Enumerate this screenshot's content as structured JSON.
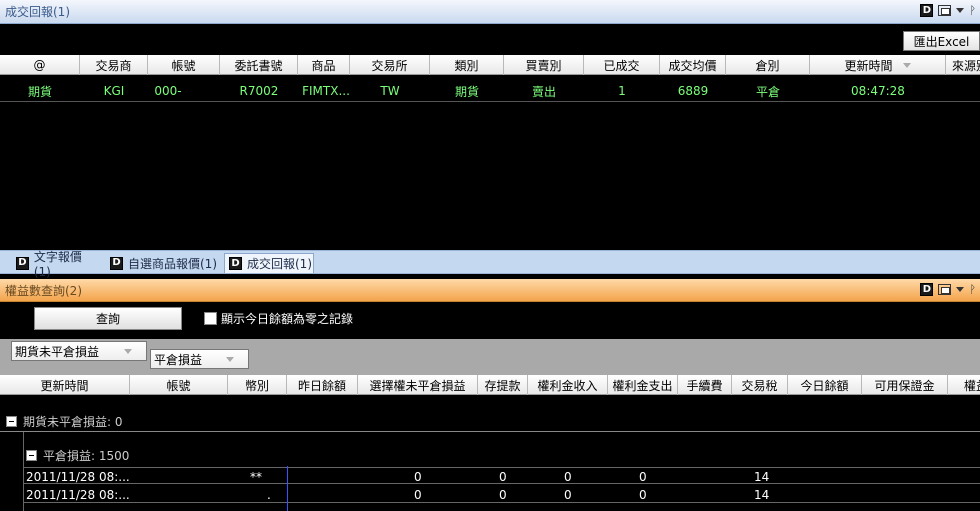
{
  "top_panel": {
    "title": "成交回報(1)",
    "excel_label": "匯出Excel",
    "columns": [
      "@",
      "交易商",
      "帳號",
      "委託書號",
      "商品",
      "交易所",
      "類別",
      "買賣別",
      "已成交",
      "成交均價",
      "倉別",
      "更新時間",
      "來源别"
    ],
    "row": [
      "期貨",
      "KGI",
      "000-",
      "R7002",
      "FIMTX...",
      "TW",
      "期貨",
      "賣出",
      "1",
      "6889",
      "平倉",
      "08:47:28",
      ""
    ]
  },
  "tabs": [
    {
      "label": "文字報價(1)",
      "icon_letter": "D"
    },
    {
      "label": "自選商品報價(1)",
      "icon_letter": "D"
    },
    {
      "label": "成交回報(1)",
      "icon_letter": "D"
    }
  ],
  "bottom_panel": {
    "title": "權益數查詢(2)",
    "query_label": "查詢",
    "checkbox_label": "顯示今日餘額為零之記錄",
    "group_chips": [
      "期貨未平倉損益",
      "平倉損益"
    ],
    "columns": [
      "更新時間",
      "帳號",
      "幣別",
      "昨日餘額",
      "選擇權未平倉損益",
      "存提款",
      "權利金收入",
      "權利金支出",
      "手續費",
      "交易稅",
      "今日餘額",
      "可用保證金",
      "權益"
    ],
    "group1_label": "期貨未平倉損益: 0",
    "group2_label": "平倉損益: 1500",
    "rows": [
      [
        "2011/11/28 08:...",
        "**",
        "0",
        "0",
        "0",
        "0",
        "14"
      ],
      [
        "2011/11/28 08:...",
        ".",
        "0",
        "0",
        "0",
        "0",
        "14"
      ]
    ]
  },
  "colors": {
    "title_blue": "#c9d9ef",
    "title_orange": "#f3a44c",
    "data_green": "#7cff7c",
    "tabs_bg": "#c4d8ef"
  }
}
